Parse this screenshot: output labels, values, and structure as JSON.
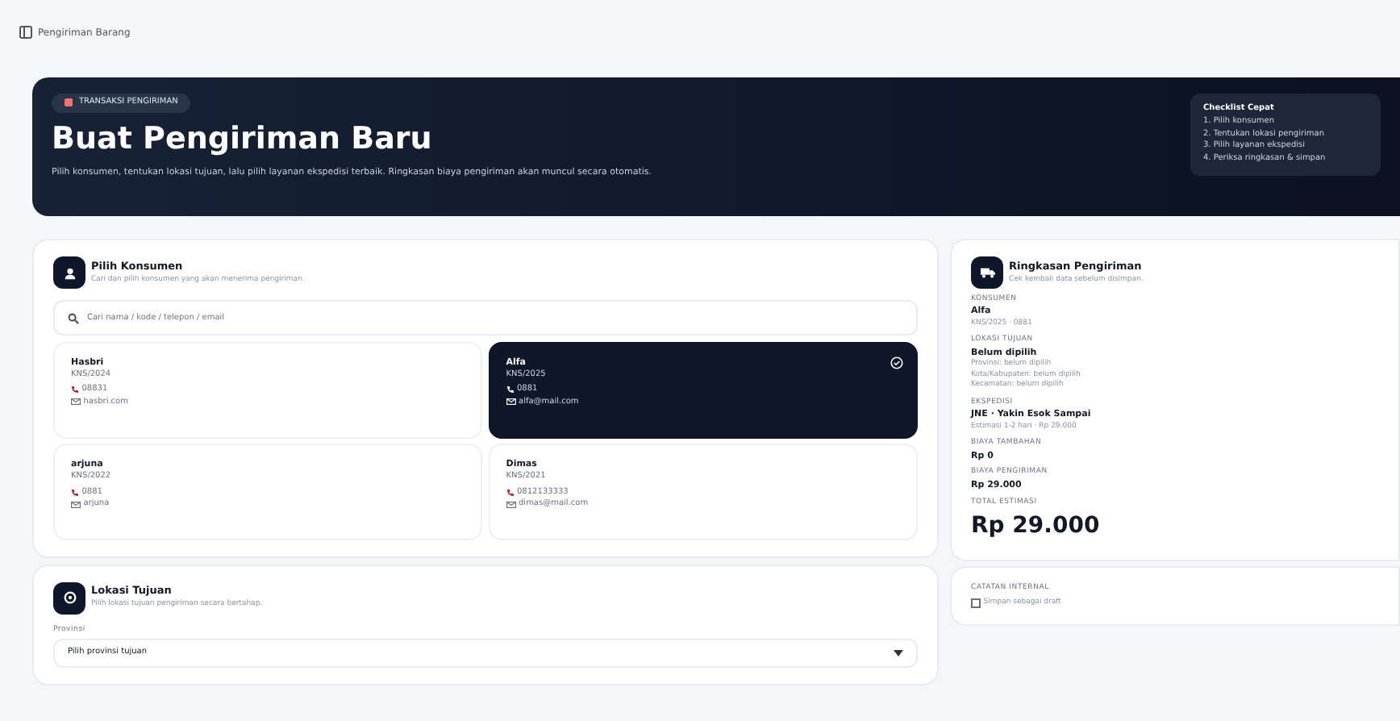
{
  "topbar": {
    "title": "Pengiriman Barang"
  },
  "hero": {
    "badge": "TRANSAKSI PENGIRIMAN",
    "title": "Buat Pengiriman Baru",
    "description": "Pilih konsumen, tentukan lokasi tujuan, lalu pilih layanan ekspedisi terbaik. Ringkasan biaya pengiriman akan muncul secara otomatis.",
    "checklist": {
      "title": "Checklist Cepat",
      "items": [
        "1. Pilih konsumen",
        "2. Tentukan lokasi pengiriman",
        "3. Pilih layanan ekspedisi",
        "4. Periksa ringkasan & simpan"
      ]
    }
  },
  "customer_panel": {
    "title": "Pilih Konsumen",
    "subtitle": "Cari dan pilih konsumen yang akan menerima pengiriman.",
    "search": {
      "placeholder": "Cari nama / kode / telepon / email"
    },
    "customers": [
      {
        "name": "Hasbri",
        "code": "KNS/2024",
        "phone": "08831",
        "email": "hasbri.com",
        "selected": false
      },
      {
        "name": "Alfa",
        "code": "KNS/2025",
        "phone": "0881",
        "email": "alfa@mail.com",
        "selected": true
      },
      {
        "name": "arjuna",
        "code": "KNS/2022",
        "phone": "0881",
        "email": "arjuna",
        "selected": false
      },
      {
        "name": "Dimas",
        "code": "KNS/2021",
        "phone": "0812133333",
        "email": "dimas@mail.com",
        "selected": false
      }
    ]
  },
  "location_panel": {
    "title": "Lokasi Tujuan",
    "subtitle": "Pilih lokasi tujuan pengiriman secara bertahap.",
    "field_label": "Provinsi",
    "select_value": "Pilih provinsi tujuan"
  },
  "summary": {
    "title": "Ringkasan Pengiriman",
    "subtitle": "Cek kembali data sebelum disimpan.",
    "sections": [
      {
        "label": "KONSUMEN",
        "value": "Alfa",
        "details": [
          "KNS/2025 · 0881"
        ]
      },
      {
        "label": "LOKASI TUJUAN",
        "value": "Belum dipilih",
        "details": [
          "Provinsi: belum dipilih",
          "Kota/Kabupaten: belum dipilih",
          "Kecamatan: belum dipilih"
        ]
      },
      {
        "label": "EKSPEDISI",
        "value": "JNE · Yakin Esok Sampai",
        "details": [
          "Estimasi 1-2 hari · Rp 29.000"
        ]
      },
      {
        "label": "BIAYA TAMBAHAN",
        "value": "Rp 0"
      },
      {
        "label": "BIAYA PENGIRIMAN",
        "value": "Rp 29.000"
      }
    ],
    "total_label": "TOTAL ESTIMASI",
    "total": "Rp 29.000"
  },
  "notes_panel": {
    "title": "CATATAN INTERNAL",
    "item": "Simpan sebagai draft"
  }
}
